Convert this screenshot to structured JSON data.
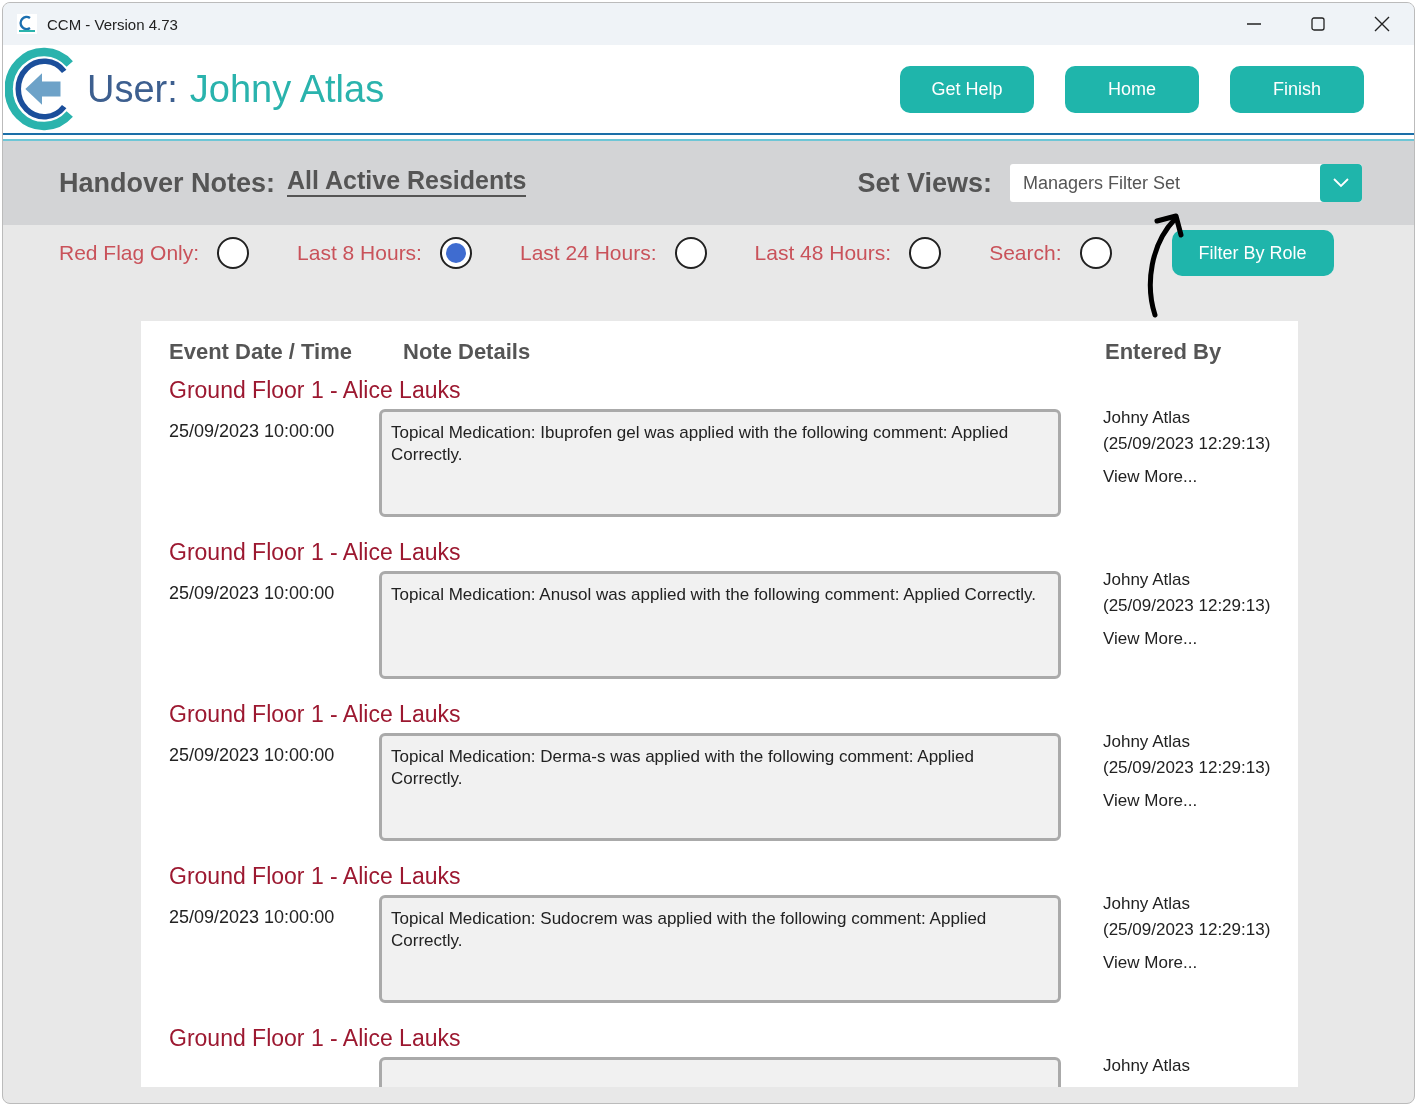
{
  "window": {
    "title": "CCM - Version 4.73"
  },
  "header": {
    "user_label": "User:",
    "user_name": "Johny Atlas",
    "buttons": [
      "Get Help",
      "Home",
      "Finish"
    ]
  },
  "filter_bar": {
    "title": "Handover Notes:",
    "scope_link": "All Active Residents",
    "views_label": "Set Views:",
    "views_value": "Managers Filter Set"
  },
  "options": [
    {
      "label": "Red Flag Only:",
      "selected": false
    },
    {
      "label": "Last 8 Hours:",
      "selected": true
    },
    {
      "label": "Last 24 Hours:",
      "selected": false
    },
    {
      "label": "Last 48 Hours:",
      "selected": false
    },
    {
      "label": "Search:",
      "selected": false
    }
  ],
  "filter_button": "Filter By Role",
  "table": {
    "columns": [
      "Event Date / Time",
      "Note Details",
      "Entered By"
    ],
    "rows": [
      {
        "heading": "Ground Floor 1 - Alice Lauks",
        "datetime": "25/09/2023 10:00:00",
        "note": "Topical Medication: Ibuprofen gel was applied with the following comment: Applied Correctly.",
        "entered_by": "Johny Atlas",
        "entered_at": "(25/09/2023 12:29:13)",
        "link": "View More..."
      },
      {
        "heading": "Ground Floor 1 - Alice Lauks",
        "datetime": "25/09/2023 10:00:00",
        "note": "Topical Medication: Anusol was applied with the following comment: Applied Correctly.",
        "entered_by": "Johny Atlas",
        "entered_at": "(25/09/2023 12:29:13)",
        "link": "View More..."
      },
      {
        "heading": "Ground Floor 1 - Alice Lauks",
        "datetime": "25/09/2023 10:00:00",
        "note": "Topical Medication: Derma-s was applied with the following comment: Applied Correctly.",
        "entered_by": "Johny Atlas",
        "entered_at": "(25/09/2023 12:29:13)",
        "link": "View More..."
      },
      {
        "heading": "Ground Floor 1 - Alice Lauks",
        "datetime": "25/09/2023 10:00:00",
        "note": "Topical Medication: Sudocrem was applied with the following comment: Applied Correctly.",
        "entered_by": "Johny Atlas",
        "entered_at": "(25/09/2023 12:29:13)",
        "link": "View More..."
      },
      {
        "heading": "Ground Floor 1 - Alice Lauks",
        "entered_by": "Johny Atlas"
      }
    ]
  }
}
